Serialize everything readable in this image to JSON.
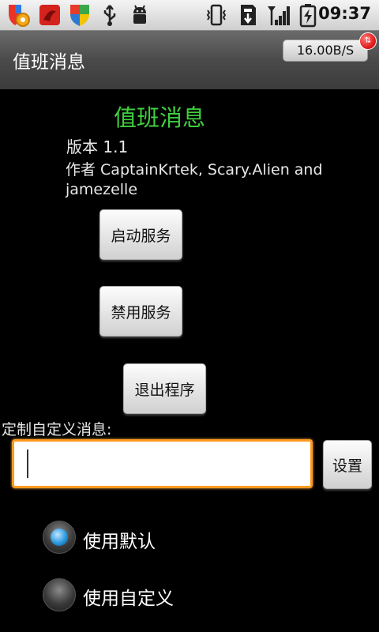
{
  "status_bar": {
    "time": "09:37",
    "icons": [
      "avast-shield-gear-icon",
      "red-app-icon",
      "shield-colored-icon",
      "usb-icon",
      "android-debug-icon",
      "vibrate-icon",
      "sd-card-icon",
      "signal-icon",
      "battery-charging-icon"
    ]
  },
  "title_bar": {
    "title": "值班消息",
    "speed": "16.00B/S",
    "speed_badge": "⇅"
  },
  "app": {
    "name": "值班消息",
    "version": "版本 1.1",
    "author": "作者 CaptainKrtek, Scary.Alien and jamezelle"
  },
  "buttons": {
    "start": "启动服务",
    "disable": "禁用服务",
    "exit": "退出程序",
    "set": "设置"
  },
  "custom": {
    "label": "定制自定义消息:",
    "value": ""
  },
  "radios": {
    "default_label": "使用默认",
    "custom_label": "使用自定义",
    "selected": "default"
  },
  "colors": {
    "accent_green": "#3ed13e",
    "focus_orange": "#ff9a1f"
  }
}
